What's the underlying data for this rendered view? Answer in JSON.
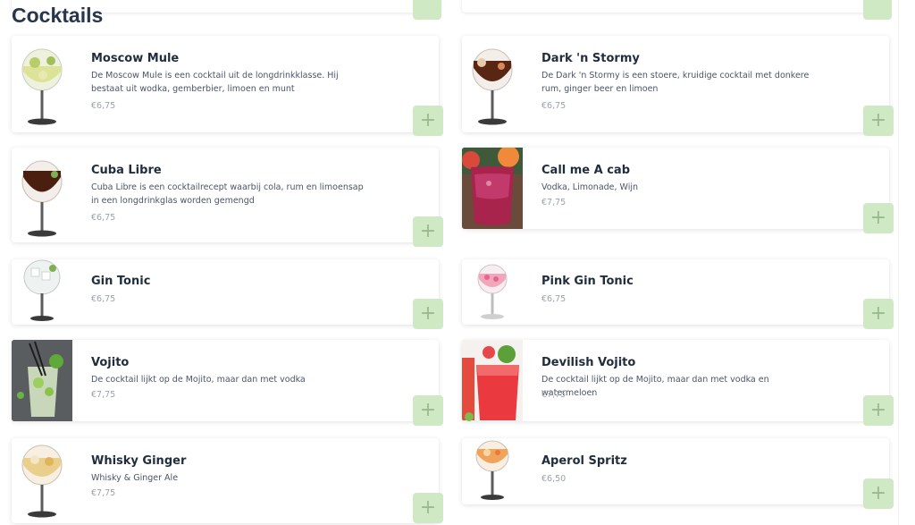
{
  "section": {
    "title": "Cocktails"
  },
  "add_button_label": "+",
  "items": [
    {
      "name": "Moscow Mule",
      "description": "De Moscow Mule is een cocktail uit de longdrinkklasse. Hij bestaat uit wodka, gemberbier, limoen en munt",
      "price": "€6,75",
      "image": "moscow-mule-glass"
    },
    {
      "name": "Dark 'n Stormy",
      "description": "De Dark 'n Stormy is een stoere, kruidige cocktail met donkere rum, ginger beer en limoen",
      "price": "€6,75",
      "image": "dark-n-stormy-glass"
    },
    {
      "name": "Cuba Libre",
      "description": "Cuba Libre is een cocktailrecept waarbij cola, rum en limoensap in een longdrinkglas worden gemengd",
      "price": "€6,75",
      "image": "cuba-libre-glass"
    },
    {
      "name": "Call me A cab",
      "description": "Vodka, Limonade, Wijn",
      "price": "€7,75",
      "image": "call-me-a-cab-photo"
    },
    {
      "name": "Gin Tonic",
      "description": "",
      "price": "€6,75",
      "image": "gin-tonic-glass"
    },
    {
      "name": "Pink Gin Tonic",
      "description": "",
      "price": "€6,75",
      "image": "pink-gin-tonic-glass"
    },
    {
      "name": "Vojito",
      "description": "De cocktail lijkt op de Mojito, maar dan met vodka",
      "price": "€7,75",
      "image": "vojito-photo"
    },
    {
      "name": "Devilish Vojito",
      "description": "De cocktail lijkt op de Mojito, maar dan met vodka en watermeloen",
      "price": "€7,75",
      "image": "devilish-vojito-photo"
    },
    {
      "name": "Whisky Ginger",
      "description": "Whisky & Ginger Ale",
      "price": "€7,75",
      "image": "whisky-ginger-glass"
    },
    {
      "name": "Aperol Spritz",
      "description": "",
      "price": "€6,50",
      "image": "aperol-spritz-glass"
    }
  ]
}
